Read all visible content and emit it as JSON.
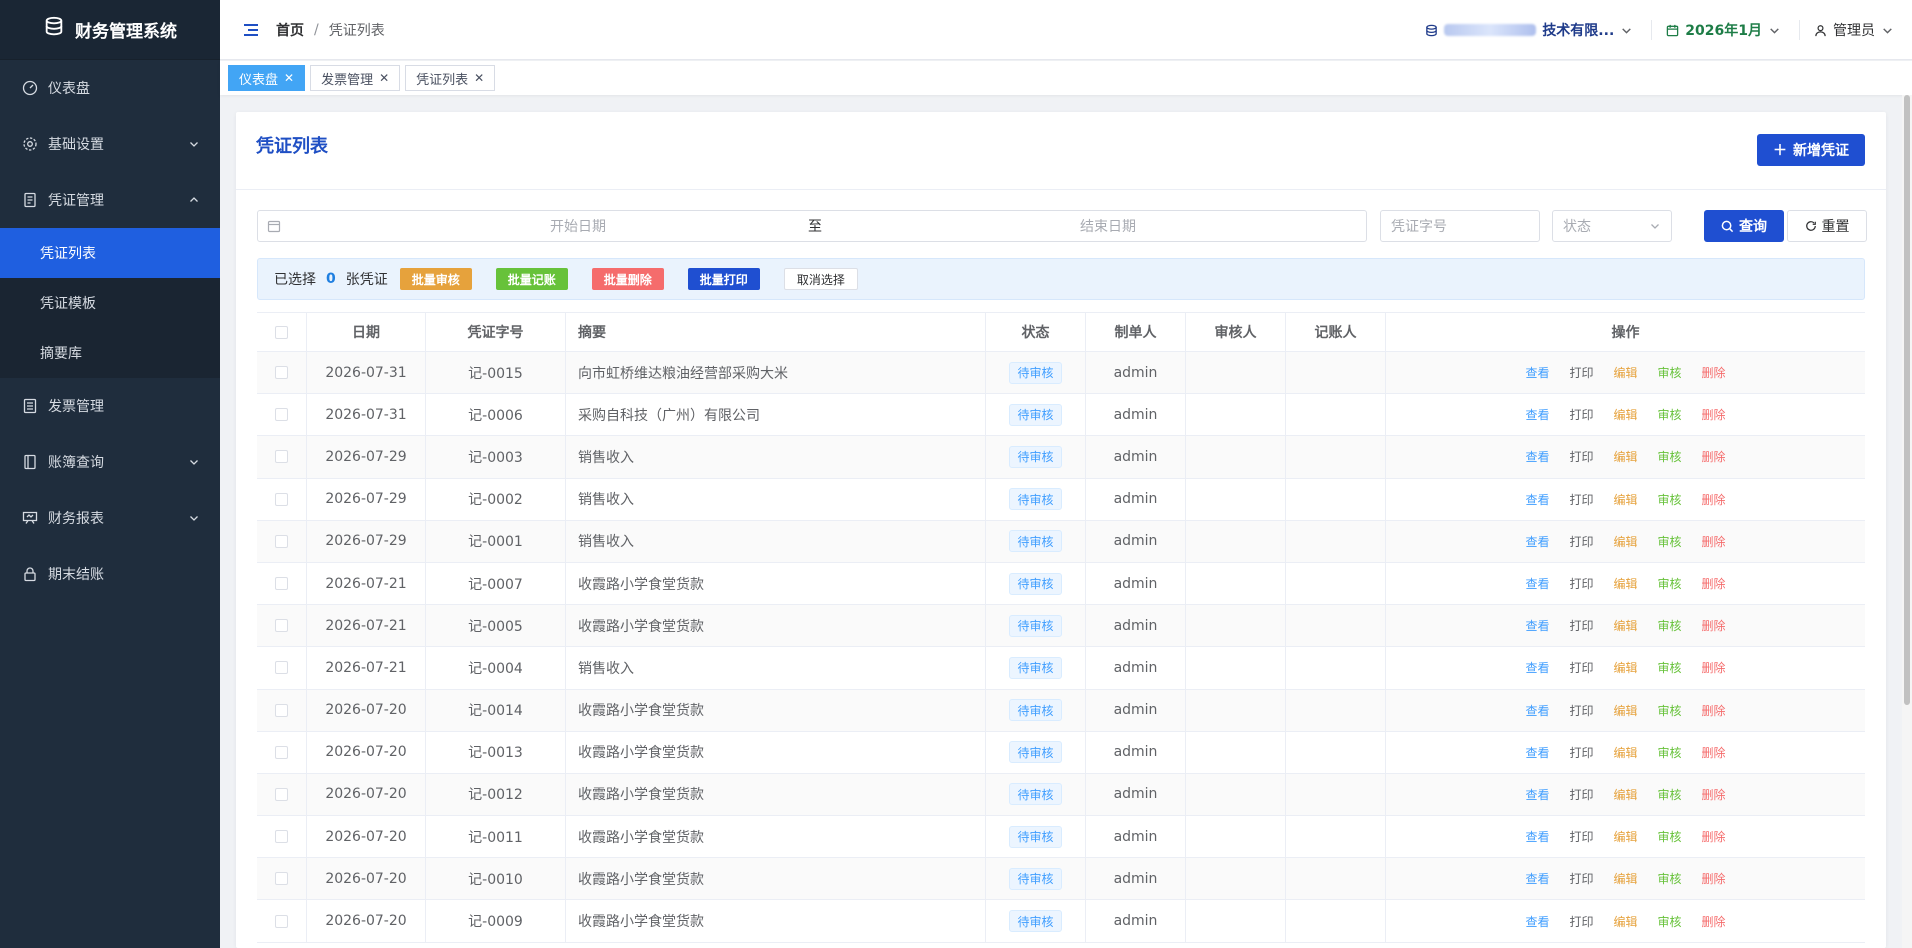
{
  "app": {
    "title": "财务管理系统"
  },
  "sidebar": {
    "items": [
      {
        "label": "仪表盘",
        "icon": "dashboard-icon"
      },
      {
        "label": "基础设置",
        "icon": "gear-icon"
      },
      {
        "label": "凭证管理",
        "icon": "voucher-icon"
      },
      {
        "label": "发票管理",
        "icon": "invoice-icon"
      },
      {
        "label": "账簿查询",
        "icon": "book-icon"
      },
      {
        "label": "财务报表",
        "icon": "report-icon"
      },
      {
        "label": "期末结账",
        "icon": "lock-icon"
      }
    ],
    "sub_items": [
      "凭证列表",
      "凭证模板",
      "摘要库"
    ]
  },
  "header": {
    "breadcrumb_home": "首页",
    "breadcrumb_sep": "/",
    "breadcrumb_current": "凭证列表",
    "company": "技术有限...",
    "period": "2026年1月",
    "user": "管理员"
  },
  "tags": [
    "仪表盘",
    "发票管理",
    "凭证列表"
  ],
  "page": {
    "title": "凭证列表",
    "add_button": "新增凭证"
  },
  "filters": {
    "start_placeholder": "开始日期",
    "range_sep": "至",
    "end_placeholder": "结束日期",
    "voucher_placeholder": "凭证字号",
    "status_placeholder": "状态",
    "query_button": "查询",
    "reset_button": "重置"
  },
  "batch": {
    "selected_prefix": "已选择",
    "selected_count": "0",
    "selected_suffix": "张凭证",
    "audit": "批量审核",
    "post": "批量记账",
    "delete": "批量删除",
    "print": "批量打印",
    "cancel": "取消选择"
  },
  "table": {
    "headers": [
      "日期",
      "凭证字号",
      "摘要",
      "状态",
      "制单人",
      "审核人",
      "记账人",
      "操作"
    ],
    "actions": [
      "查看",
      "打印",
      "编辑",
      "审核",
      "删除"
    ],
    "rows": [
      {
        "date": "2026-07-31",
        "no": "记-0015",
        "summary": "向市虹桥维达粮油经营部采购大米",
        "status": "待审核",
        "maker": "admin"
      },
      {
        "date": "2026-07-31",
        "no": "记-0006",
        "summary": "采购自科技（广州）有限公司",
        "status": "待审核",
        "maker": "admin"
      },
      {
        "date": "2026-07-29",
        "no": "记-0003",
        "summary": "销售收入",
        "status": "待审核",
        "maker": "admin"
      },
      {
        "date": "2026-07-29",
        "no": "记-0002",
        "summary": "销售收入",
        "status": "待审核",
        "maker": "admin"
      },
      {
        "date": "2026-07-29",
        "no": "记-0001",
        "summary": "销售收入",
        "status": "待审核",
        "maker": "admin"
      },
      {
        "date": "2026-07-21",
        "no": "记-0007",
        "summary": "收霞路小学食堂货款",
        "status": "待审核",
        "maker": "admin"
      },
      {
        "date": "2026-07-21",
        "no": "记-0005",
        "summary": "收霞路小学食堂货款",
        "status": "待审核",
        "maker": "admin"
      },
      {
        "date": "2026-07-21",
        "no": "记-0004",
        "summary": "销售收入",
        "status": "待审核",
        "maker": "admin"
      },
      {
        "date": "2026-07-20",
        "no": "记-0014",
        "summary": "收霞路小学食堂货款",
        "status": "待审核",
        "maker": "admin"
      },
      {
        "date": "2026-07-20",
        "no": "记-0013",
        "summary": "收霞路小学食堂货款",
        "status": "待审核",
        "maker": "admin"
      },
      {
        "date": "2026-07-20",
        "no": "记-0012",
        "summary": "收霞路小学食堂货款",
        "status": "待审核",
        "maker": "admin"
      },
      {
        "date": "2026-07-20",
        "no": "记-0011",
        "summary": "收霞路小学食堂货款",
        "status": "待审核",
        "maker": "admin"
      },
      {
        "date": "2026-07-20",
        "no": "记-0010",
        "summary": "收霞路小学食堂货款",
        "status": "待审核",
        "maker": "admin"
      },
      {
        "date": "2026-07-20",
        "no": "记-0009",
        "summary": "收霞路小学食堂货款",
        "status": "待审核",
        "maker": "admin"
      }
    ]
  },
  "colors": {
    "sidebar_bg": "#1f2d3d",
    "active_menu": "#1f5fe0",
    "primary": "#1f4fd1",
    "tag_active": "#42a5f5"
  }
}
